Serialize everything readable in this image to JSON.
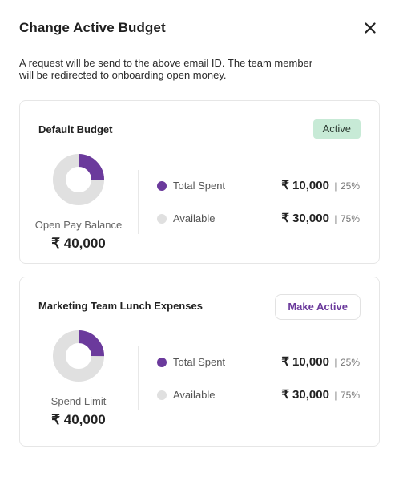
{
  "dialog": {
    "title": "Change Active Budget",
    "description": "A request will be send to the above email ID. The team member will be redirected to onboarding open money."
  },
  "colors": {
    "spent": "#6b3a9c",
    "available": "#e0e0e0",
    "active_badge_bg": "#c7ead6",
    "accent": "#6b3a9c"
  },
  "budgets": [
    {
      "name": "Default Budget",
      "status_label": "Active",
      "is_active": true,
      "donut_label": "Open Pay Balance",
      "total_amount": "₹ 40,000",
      "spent_fraction": 0.25,
      "stats": [
        {
          "label": "Total Spent",
          "amount": "₹ 10,000",
          "separator": "|",
          "percent": "25%"
        },
        {
          "label": "Available",
          "amount": "₹ 30,000",
          "separator": "|",
          "percent": "75%"
        }
      ]
    },
    {
      "name": "Marketing Team Lunch Expenses",
      "action_label": "Make Active",
      "is_active": false,
      "donut_label": "Spend Limit",
      "total_amount": "₹ 40,000",
      "spent_fraction": 0.25,
      "stats": [
        {
          "label": "Total Spent",
          "amount": "₹ 10,000",
          "separator": "|",
          "percent": "25%"
        },
        {
          "label": "Available",
          "amount": "₹ 30,000",
          "separator": "|",
          "percent": "75%"
        }
      ]
    }
  ]
}
